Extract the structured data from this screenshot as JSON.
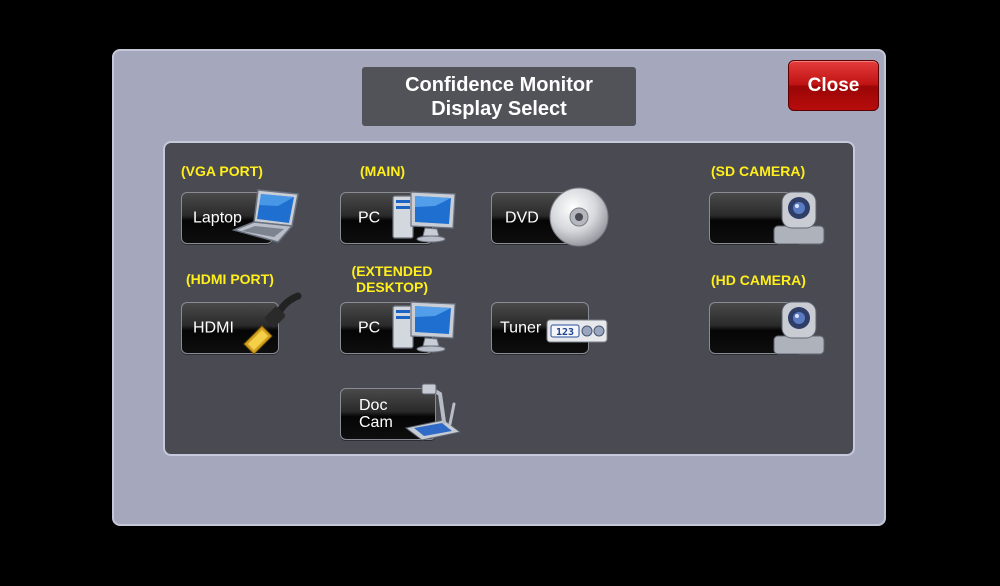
{
  "title": {
    "line1": "Confidence Monitor",
    "line2": "Display Select"
  },
  "close_label": "Close",
  "labels": {
    "vga_port": "(VGA PORT)",
    "main": "(MAIN)",
    "sd_camera": "(SD CAMERA)",
    "hdmi_port": "(HDMI PORT)",
    "extended_line1": "(EXTENDED",
    "extended_line2": "DESKTOP)",
    "hd_camera": "(HD CAMERA)"
  },
  "buttons": {
    "laptop": "Laptop",
    "pc_main": "PC",
    "dvd": "DVD",
    "hdmi": "HDMI",
    "pc_extended": "PC",
    "tuner": "Tuner",
    "doccam_line1": "Doc",
    "doccam_line2": "Cam",
    "tuner_display": "123"
  },
  "colors": {
    "label_yellow": "#ffef1a",
    "close_red": "#c11313",
    "panel": "#a5a8bd",
    "inner": "#4a4b52"
  },
  "icons": [
    "laptop-icon",
    "pc-monitor-icon",
    "dvd-disc-icon",
    "hdmi-plug-icon",
    "tuner-icon",
    "document-camera-icon",
    "ptz-camera-icon"
  ]
}
